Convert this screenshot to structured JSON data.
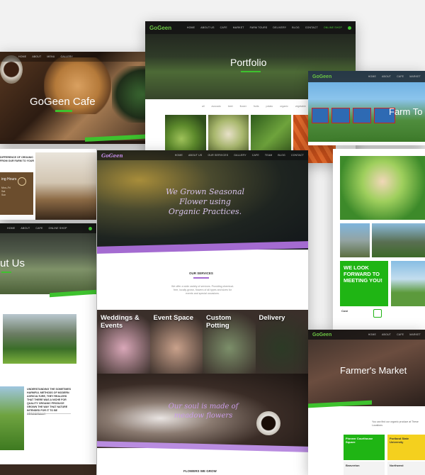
{
  "cafe": {
    "title": "GoGeen Cafe",
    "logo": "GoGeen",
    "sub": "",
    "box_heading": "DIFFERENCE OF ORGANIC FROM OUR FARM TO YOUR",
    "hours": "ing Hours"
  },
  "portfolio": {
    "logo": "GoGeen",
    "title": "Portfolio",
    "nav": [
      "HOME",
      "ABOUT US",
      "CAFE",
      "MARKET",
      "FARM TOURS",
      "DELIVERY",
      "BLOG",
      "CONTACT",
      "ONLINE SHOP"
    ],
    "filters": [
      "all",
      "avocado",
      "beet",
      "flower",
      "fruits",
      "potato",
      "organic",
      "vegetable"
    ]
  },
  "tours": {
    "title": "Farm To",
    "logo": "GoGeen"
  },
  "about": {
    "title": "ut Us",
    "text": "UNDERSTANDING THE SOMETIMES HARMFUL METHODS OF MODERN AGRICULTURE, THEY REALIZED THAT THERE WAS A NICHE FOR QUALITY ORGANIC PRODUCE GROWN THE WAY THAT NATURE INTENDED FOR IT TO BE ORGANICALLY."
  },
  "flowers": {
    "logo": "GoGeen",
    "nav": [
      "HOME",
      "ABOUT US",
      "OUR SERVICES",
      "GALLERY",
      "CAFE",
      "TEAM",
      "BLOG",
      "CONTACT"
    ],
    "hero": "We Grown Seasonal Flower using Organic Practices.",
    "section": "OUR SERVICES",
    "intro": "We offer a wide variety of services. Providing chemical-free, locally grown, flowers of all types and sizes for events and special occasions.",
    "services": [
      {
        "title": "Weddings & Events",
        "color": "#d9a7b8"
      },
      {
        "title": "Event Space",
        "color": "#c9a18b"
      },
      {
        "title": "Custom Potting",
        "color": "#7c8f6a"
      },
      {
        "title": "Delivery",
        "color": "#2c3a26"
      }
    ],
    "banner": "Our soul is made of meadow flowers",
    "footer": "FLOWERS WE GROW"
  },
  "meeting": {
    "text": "WE LOOK FORWARD TO MEETING YOU!",
    "label": "Cost"
  },
  "market": {
    "logo": "GoGeen",
    "title": "Farmer's Market",
    "find": "You can find our organic produce at These Locations",
    "boxes": [
      "Portland State University",
      "Northwest"
    ],
    "boxes2": [
      "Pioneer Courthouse Square",
      "Beaverton"
    ]
  },
  "colors": {
    "accent": "#3ec22e",
    "purple": "#a46bd1"
  }
}
